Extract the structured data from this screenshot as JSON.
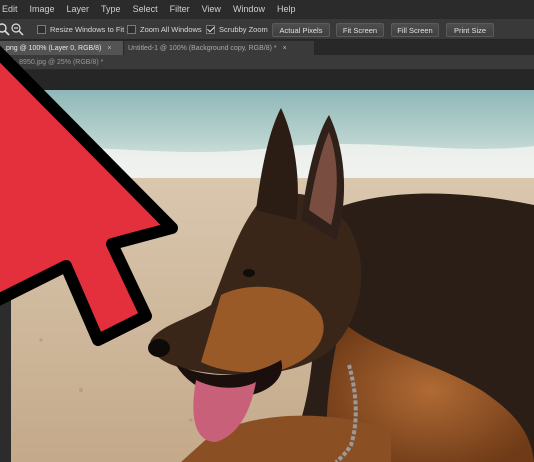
{
  "menu": [
    "Edit",
    "Image",
    "Layer",
    "Type",
    "Select",
    "Filter",
    "View",
    "Window",
    "Help"
  ],
  "options": {
    "resize_windows": "Resize Windows to Fit",
    "zoom_all": "Zoom All Windows",
    "scrubby_zoom": "Scrubby Zoom",
    "resize_checked": false,
    "zoom_all_checked": false,
    "scrubby_checked": true,
    "buttons": {
      "actual_pixels": "Actual Pixels",
      "fit_screen": "Fit Screen",
      "fill_screen": "Fill Screen",
      "print_size": "Print Size"
    }
  },
  "tabs": [
    {
      "label": ".png @ 100% (Layer 0, RGB/8)",
      "close": "×",
      "active": true
    },
    {
      "label": "Untitled-1 @ 100% (Background copy, RGB/8) *",
      "close": "×",
      "active": false
    }
  ],
  "doc_tab": {
    "label": "MG_8950.jpg @ 25% (RGB/8) *"
  },
  "icons": {
    "zoom_tool": "zoom-tool-icon",
    "zoom_out": "zoom-out-icon",
    "arrow": "red-pointer-arrow"
  },
  "colors": {
    "arrow_fill": "#e3303c",
    "arrow_stroke": "#000000"
  }
}
